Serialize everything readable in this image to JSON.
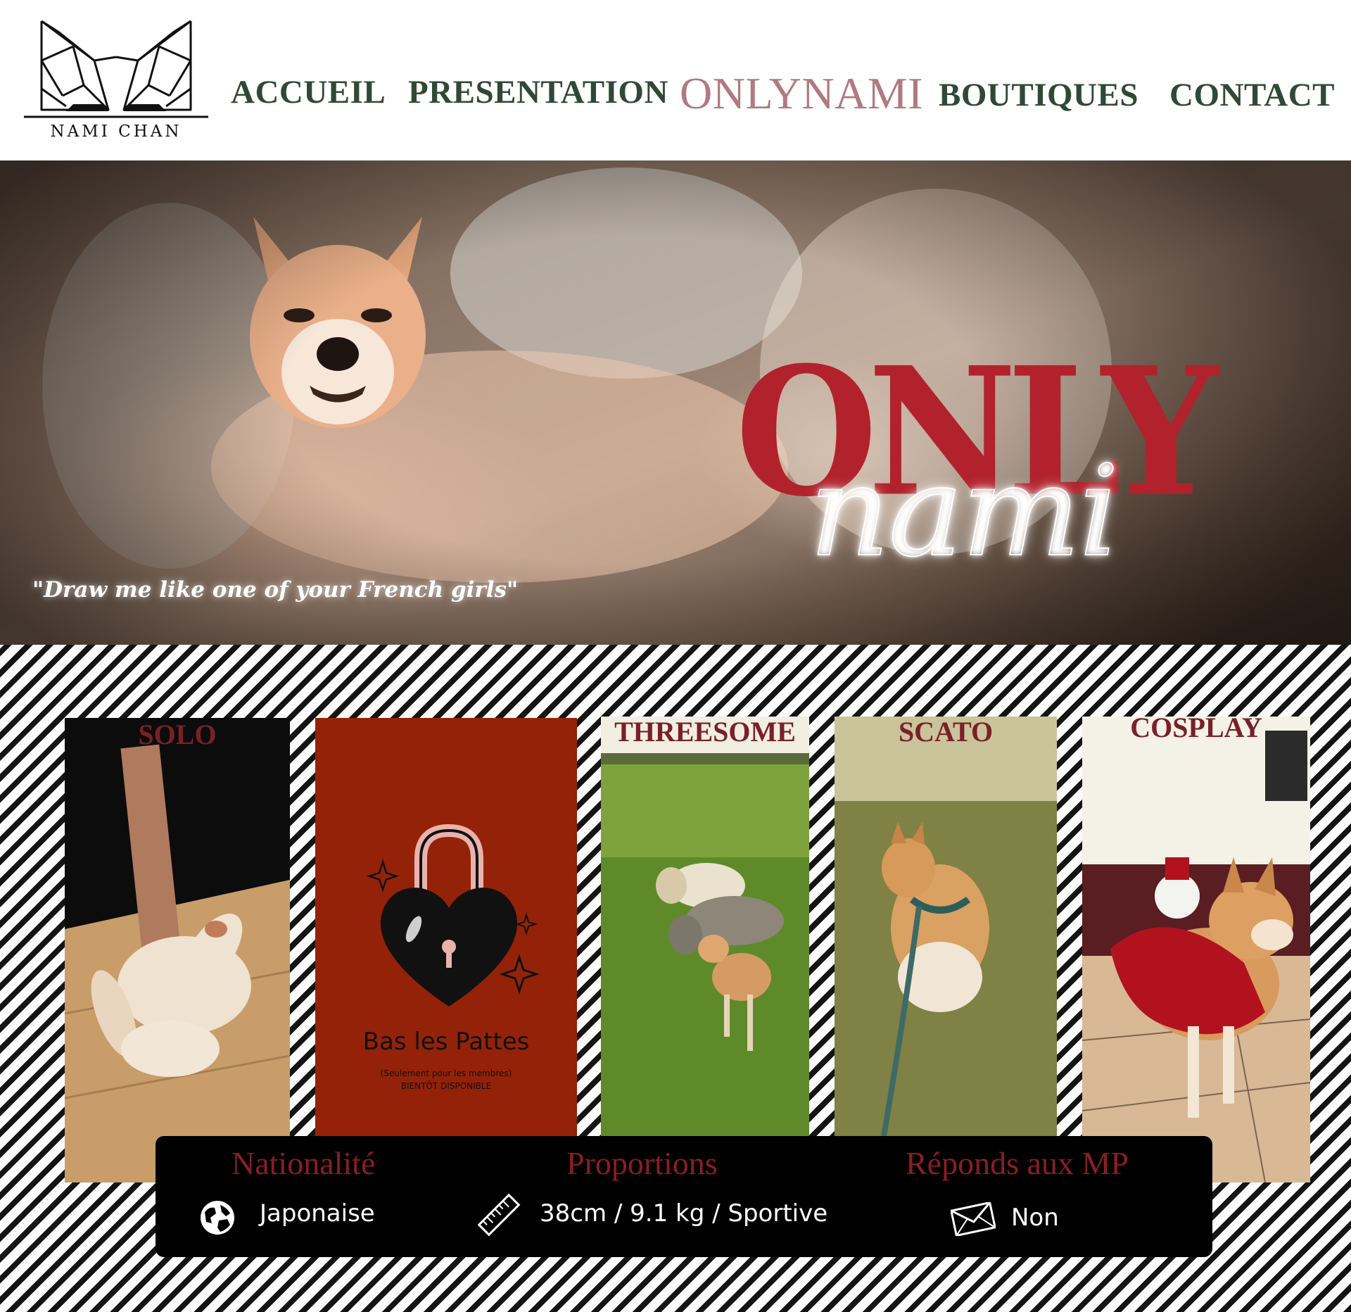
{
  "logo": {
    "text": "NAMI CHAN"
  },
  "nav": {
    "accueil": "ACCUEIL",
    "presentation": "PRESENTATION",
    "onlynami": "ONLYNAMI",
    "boutiques": "BOUTIQUES",
    "contact": "CONTACT"
  },
  "hero": {
    "title_only": "ONLY",
    "title_nami": "nami",
    "quote": "\"Draw me like one of your French girls\""
  },
  "cards": [
    {
      "title": "SOLO"
    },
    {
      "title": "Bas les Pattes",
      "subtitle": "(Seulement pour les membres)",
      "note": "BIENTÔT DISPONIBLE"
    },
    {
      "title": "THREESOME"
    },
    {
      "title": "SCATO"
    },
    {
      "title": "COSPLAY"
    }
  ],
  "info": {
    "nationality": {
      "label": "Nationalité",
      "value": "Japonaise",
      "icon": "globe-icon"
    },
    "proportions": {
      "label": "Proportions",
      "value": "38cm / 9.1 kg / Sportive",
      "icon": "ruler-icon"
    },
    "messages": {
      "label": "Réponds aux MP",
      "value": "Non",
      "icon": "envelope-icon"
    }
  },
  "colors": {
    "nav_text": "#2e4a35",
    "nav_active": "#b07a80",
    "title_red": "#b1222c",
    "locked_bg": "#942208",
    "info_label": "#8a1e22"
  }
}
